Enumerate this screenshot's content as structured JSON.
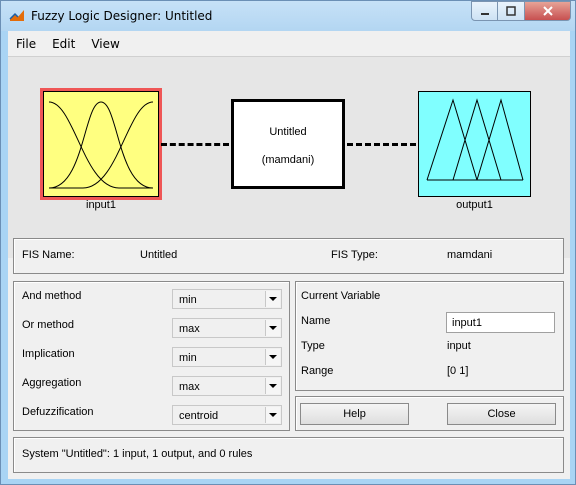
{
  "window": {
    "title": "Fuzzy Logic Designer: Untitled"
  },
  "menu": [
    "File",
    "Edit",
    "View"
  ],
  "diagram": {
    "input_label": "input1",
    "output_label": "output1",
    "fis_name": "Untitled",
    "fis_type": "(mamdani)",
    "colors": {
      "input_fill": "#ffff80",
      "input_selected_border": "#ef5656",
      "output_fill": "#80ffff"
    }
  },
  "fis_info": {
    "name_label": "FIS Name:",
    "name_value": "Untitled",
    "type_label": "FIS Type:",
    "type_value": "mamdani"
  },
  "methods": [
    {
      "label": "And method",
      "value": "min"
    },
    {
      "label": "Or method",
      "value": "max"
    },
    {
      "label": "Implication",
      "value": "min"
    },
    {
      "label": "Aggregation",
      "value": "max"
    },
    {
      "label": "Defuzzification",
      "value": "centroid"
    }
  ],
  "current_variable": {
    "heading": "Current Variable",
    "name_label": "Name",
    "name_value": "input1",
    "type_label": "Type",
    "type_value": "input",
    "range_label": "Range",
    "range_value": "[0 1]"
  },
  "buttons": {
    "help": "Help",
    "close": "Close"
  },
  "status": "System \"Untitled\": 1 input, 1 output, and 0 rules"
}
